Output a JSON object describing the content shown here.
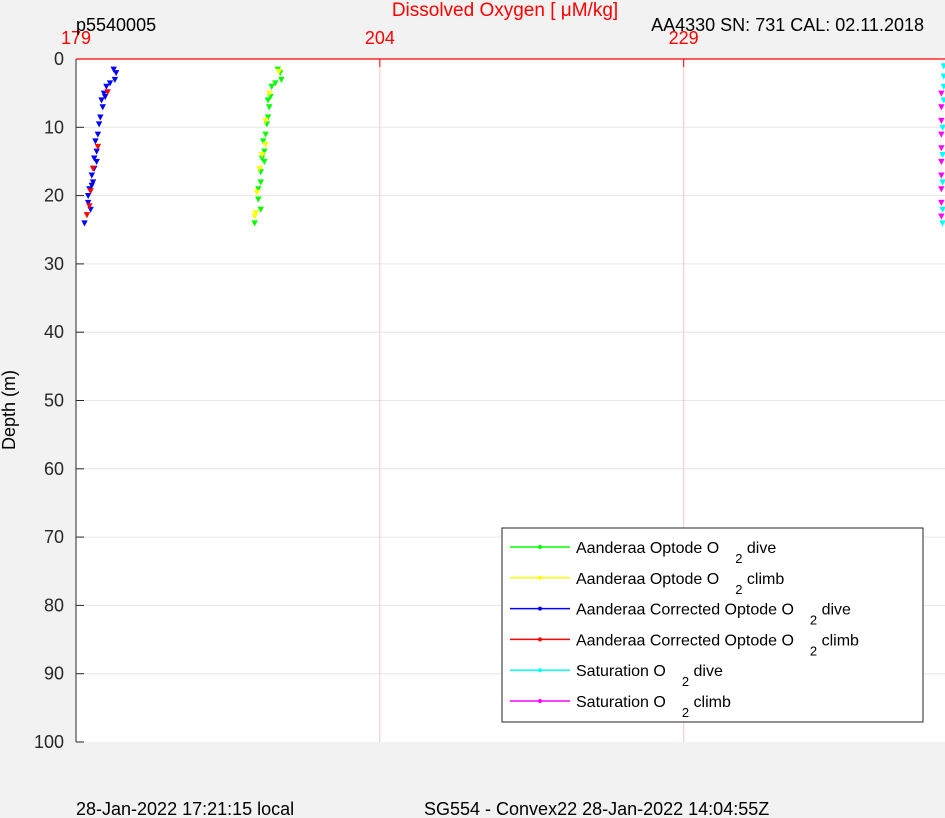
{
  "chart_data": {
    "type": "scatter",
    "title": "Dissolved Oxygen [ μM/kg]",
    "ylabel": "Depth (m)",
    "header_left": "p5540005",
    "header_right": "AA4330  SN: 731  CAL: 02.11.2018",
    "footer_left": "28-Jan-2022 17:21:15 local",
    "footer_center": "SG554 - Convex22 28-Jan-2022 14:04:55Z",
    "xlim": [
      179,
      250.5
    ],
    "ylim": [
      0,
      100
    ],
    "x_axis_location": "top",
    "y_reversed": true,
    "xticks": [
      179,
      204,
      229
    ],
    "yticks": [
      0,
      10,
      20,
      30,
      40,
      50,
      60,
      70,
      80,
      90,
      100
    ],
    "grid": true,
    "legend_position": "bottom-right",
    "colors": {
      "title": "#ff0000",
      "xaxis": "#ff0000",
      "grid": "#e6e6e6",
      "xgrid": "#f3c7c7"
    },
    "series": [
      {
        "name": "Aanderaa Optode O2 dive",
        "color": "#00ff00",
        "points": [
          [
            195.6,
            1.5
          ],
          [
            195.8,
            2
          ],
          [
            195.9,
            3
          ],
          [
            195.4,
            3.5
          ],
          [
            195.1,
            4
          ],
          [
            195.0,
            5.5
          ],
          [
            194.8,
            6
          ],
          [
            194.9,
            7
          ],
          [
            194.8,
            8.5
          ],
          [
            194.7,
            9.5
          ],
          [
            194.6,
            11
          ],
          [
            194.4,
            12
          ],
          [
            194.5,
            13.5
          ],
          [
            194.3,
            14.5
          ],
          [
            194.5,
            15
          ],
          [
            194.2,
            16.5
          ],
          [
            194.2,
            18
          ],
          [
            194.0,
            19
          ],
          [
            194.0,
            20.5
          ],
          [
            194.2,
            22
          ],
          [
            193.7,
            24
          ]
        ]
      },
      {
        "name": "Aanderaa Optode O2 climb",
        "color": "#ffff00",
        "points": [
          [
            195.7,
            1.8
          ],
          [
            194.9,
            5
          ],
          [
            194.6,
            9
          ],
          [
            194.6,
            12.5
          ],
          [
            194.3,
            14
          ],
          [
            194.1,
            16
          ],
          [
            193.9,
            19.5
          ],
          [
            193.8,
            22.5
          ],
          [
            193.7,
            23
          ]
        ]
      },
      {
        "name": "Aanderaa Corrected Optode O2 dive",
        "color": "#0000ff",
        "points": [
          [
            182.1,
            1.5
          ],
          [
            182.3,
            2
          ],
          [
            182.2,
            3
          ],
          [
            181.8,
            3.5
          ],
          [
            181.5,
            4
          ],
          [
            181.3,
            5
          ],
          [
            181.4,
            5.5
          ],
          [
            181.1,
            6
          ],
          [
            181.2,
            7
          ],
          [
            181.0,
            8.5
          ],
          [
            180.9,
            9.5
          ],
          [
            180.8,
            11
          ],
          [
            180.6,
            12
          ],
          [
            180.7,
            13.5
          ],
          [
            180.5,
            14.5
          ],
          [
            180.7,
            15
          ],
          [
            180.5,
            16
          ],
          [
            180.3,
            17
          ],
          [
            180.4,
            18
          ],
          [
            180.3,
            18.5
          ],
          [
            180.1,
            19
          ],
          [
            180.0,
            20
          ],
          [
            180.0,
            21
          ],
          [
            180.2,
            22
          ],
          [
            179.7,
            24
          ]
        ]
      },
      {
        "name": "Aanderaa Corrected Optode O2 climb",
        "color": "#ff0000",
        "points": [
          [
            181.6,
            4.8
          ],
          [
            180.8,
            12.8
          ],
          [
            180.4,
            16
          ],
          [
            180.2,
            19.3
          ],
          [
            180.1,
            21.5
          ],
          [
            179.9,
            22.8
          ]
        ]
      },
      {
        "name": "Saturation O2 dive",
        "color": "#00ffff",
        "points": [
          [
            250.4,
            1
          ],
          [
            250.4,
            2.5
          ],
          [
            250.4,
            4
          ],
          [
            250.4,
            6
          ],
          [
            250.3,
            10
          ],
          [
            250.3,
            14
          ],
          [
            250.3,
            18
          ],
          [
            250.3,
            22
          ],
          [
            250.3,
            24
          ]
        ]
      },
      {
        "name": "Saturation O2 climb",
        "color": "#ff00ff",
        "points": [
          [
            250.2,
            5
          ],
          [
            250.2,
            7
          ],
          [
            250.2,
            9
          ],
          [
            250.2,
            11
          ],
          [
            250.2,
            13
          ],
          [
            250.2,
            15
          ],
          [
            250.2,
            17
          ],
          [
            250.2,
            19
          ],
          [
            250.2,
            21
          ],
          [
            250.2,
            23
          ]
        ]
      }
    ],
    "legend": [
      {
        "label": "Aanderaa Optode O",
        "sub": "2",
        "suffix": " dive",
        "color": "#00ff00"
      },
      {
        "label": "Aanderaa Optode O",
        "sub": "2",
        "suffix": " climb",
        "color": "#ffff00"
      },
      {
        "label": "Aanderaa Corrected Optode O",
        "sub": "2",
        "suffix": " dive",
        "color": "#0000ff"
      },
      {
        "label": "Aanderaa Corrected Optode O",
        "sub": "2",
        "suffix": " climb",
        "color": "#ff0000"
      },
      {
        "label": "Saturation O",
        "sub": "2",
        "suffix": " dive",
        "color": "#00ffff"
      },
      {
        "label": "Saturation O",
        "sub": "2",
        "suffix": " climb",
        "color": "#ff00ff"
      }
    ]
  }
}
